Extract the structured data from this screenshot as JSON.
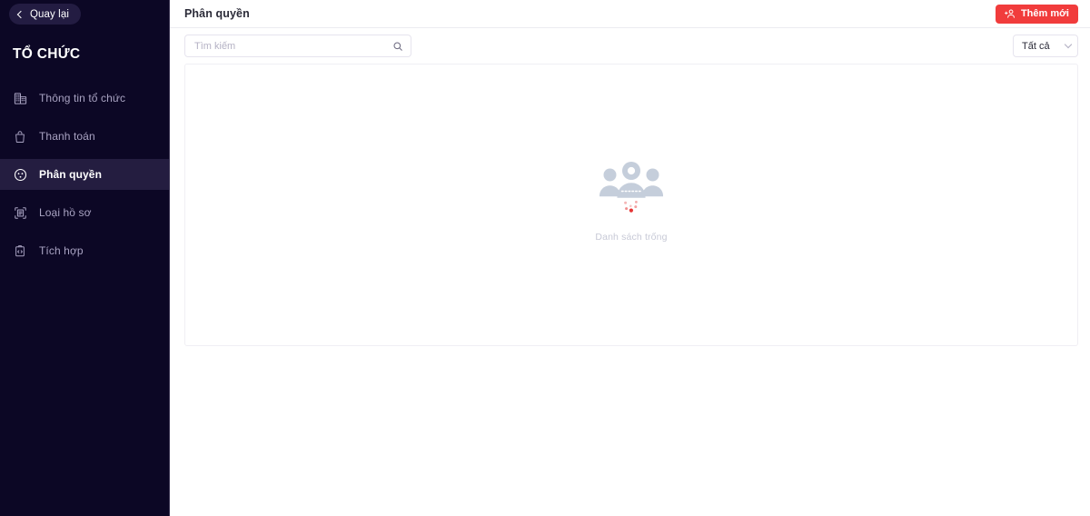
{
  "sidebar": {
    "back_label": "Quay lại",
    "back_icon": "chevron-left-icon",
    "section_title": "TỔ CHỨC",
    "items": [
      {
        "label": "Thông tin tổ chức",
        "icon": "building-icon",
        "active": false
      },
      {
        "label": "Thanh toán",
        "icon": "bag-icon",
        "active": false
      },
      {
        "label": "Phân quyền",
        "icon": "permission-face-icon",
        "active": true
      },
      {
        "label": "Loại hồ sơ",
        "icon": "document-scan-icon",
        "active": false
      },
      {
        "label": "Tích hợp",
        "icon": "code-clipboard-icon",
        "active": false
      }
    ],
    "background_color": "#0c0725",
    "active_item_color": "#241d40"
  },
  "header": {
    "title": "Phân quyền",
    "add_button": {
      "label": "Thêm mới",
      "icon": "add-user-icon",
      "color": "#f13c3c"
    }
  },
  "toolbar": {
    "search": {
      "placeholder": "Tìm kiếm",
      "value": "",
      "icon": "search-icon"
    },
    "filter": {
      "selected": "Tất cả",
      "icon": "chevron-down-icon",
      "options": [
        "Tất cả"
      ]
    }
  },
  "content": {
    "empty_state": {
      "illustration": "empty-people-group-icon",
      "message": "Danh sách trống"
    }
  }
}
